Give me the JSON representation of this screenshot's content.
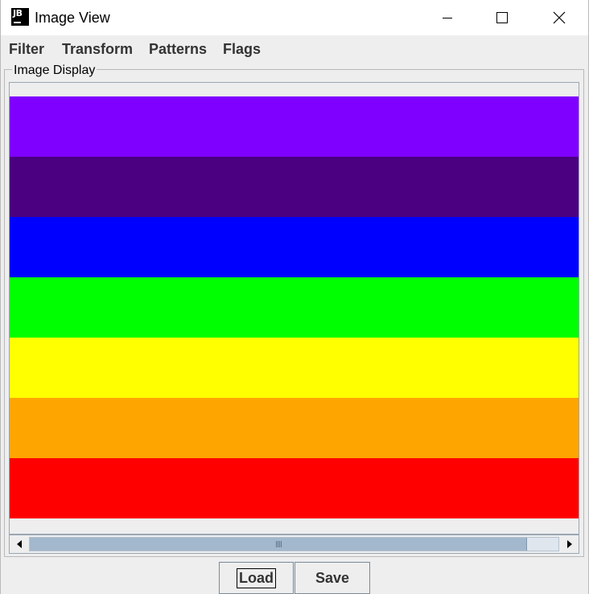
{
  "window": {
    "title": "Image View",
    "icon_text": "JB",
    "controls": [
      "minimize-icon",
      "maximize-icon",
      "close-icon"
    ]
  },
  "menu": {
    "filter": "Filter",
    "transform": "Transform",
    "patterns": "Patterns",
    "flags": "Flags"
  },
  "panel": {
    "title": "Image Display"
  },
  "image": {
    "stripes": [
      {
        "color": "#7f00ff"
      },
      {
        "color": "#4a0080"
      },
      {
        "color": "#0000ff"
      },
      {
        "color": "#00ff00"
      },
      {
        "color": "#ffff00"
      },
      {
        "color": "#ffa500"
      },
      {
        "color": "#ff0000"
      }
    ]
  },
  "scrollbar": {
    "visible_fraction": 0.94,
    "position_fraction": 0
  },
  "buttons": {
    "load": "Load",
    "save": "Save"
  }
}
